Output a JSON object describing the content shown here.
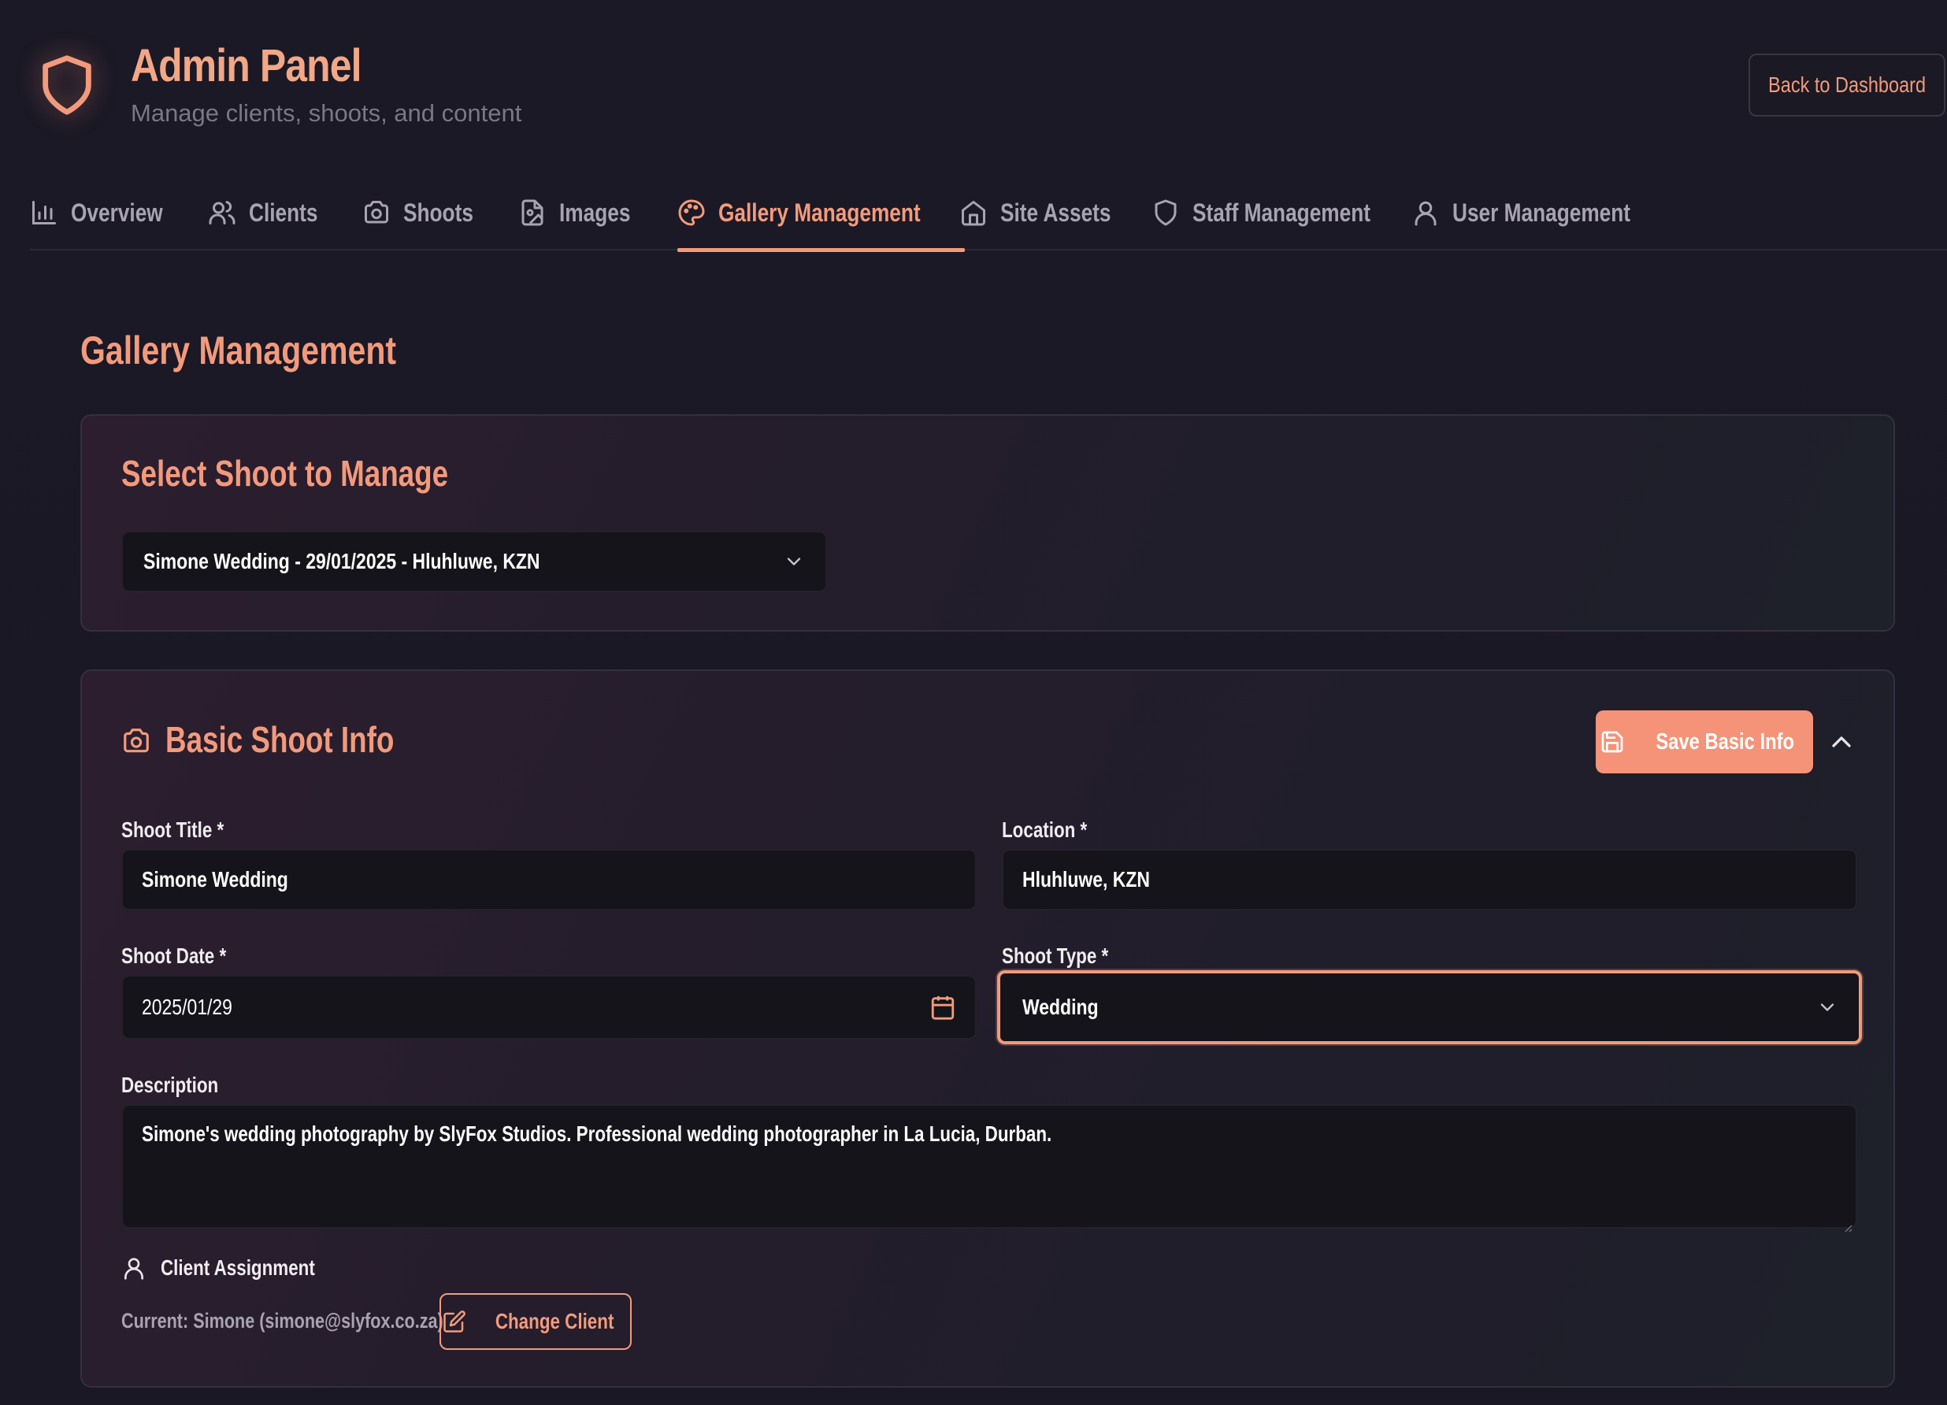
{
  "header": {
    "title": "Admin Panel",
    "subtitle": "Manage clients, shoots, and content",
    "back_button": "Back to Dashboard",
    "logo_icon": "shield-icon"
  },
  "tabs": [
    {
      "label": "Overview",
      "icon": "bar-chart-icon",
      "active": false
    },
    {
      "label": "Clients",
      "icon": "users-icon",
      "active": false
    },
    {
      "label": "Shoots",
      "icon": "camera-icon",
      "active": false
    },
    {
      "label": "Images",
      "icon": "image-file-icon",
      "active": false
    },
    {
      "label": "Gallery Management",
      "icon": "palette-icon",
      "active": true
    },
    {
      "label": "Site Assets",
      "icon": "home-icon",
      "active": false
    },
    {
      "label": "Staff Management",
      "icon": "shield-icon",
      "active": false
    },
    {
      "label": "User Management",
      "icon": "user-icon",
      "active": false
    }
  ],
  "page": {
    "title": "Gallery Management"
  },
  "select_shoot": {
    "title": "Select Shoot to Manage",
    "selected": "Simone Wedding - 29/01/2025 - Hluhluwe, KZN"
  },
  "basic_info": {
    "title": "Basic Shoot Info",
    "save_label": "Save Basic Info",
    "fields": {
      "shoot_title": {
        "label": "Shoot Title *",
        "value": "Simone Wedding"
      },
      "location": {
        "label": "Location *",
        "value": "Hluhluwe, KZN"
      },
      "shoot_date": {
        "label": "Shoot Date *",
        "value": "2025/01/29"
      },
      "shoot_type": {
        "label": "Shoot Type *",
        "value": "Wedding"
      },
      "description": {
        "label": "Description",
        "value": "Simone's wedding photography by SlyFox Studios. Professional wedding photographer in La Lucia, Durban."
      }
    },
    "client": {
      "label": "Client Assignment",
      "current": "Current: Simone (simone@slyfox.co.za)",
      "change_label": "Change Client"
    }
  },
  "colors": {
    "accent": "#f39a7c",
    "button_fill": "#f49378",
    "background": "#1a1825",
    "input_bg": "#15141a"
  }
}
